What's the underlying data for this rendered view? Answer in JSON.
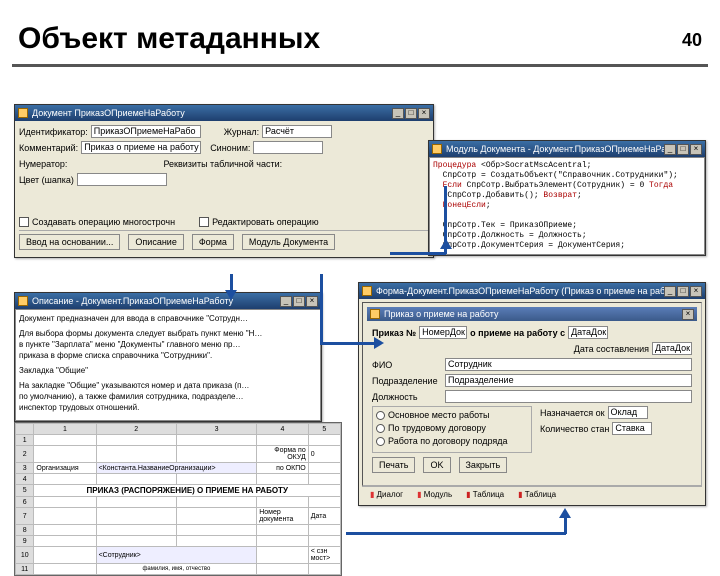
{
  "page_number": "40",
  "heading": "Объект метаданных",
  "doc_win": {
    "title": "Документ ПриказОПриемеНаРаботу",
    "labels": {
      "ident": "Идентификатор:",
      "ident_val": "ПриказОПриемеНаРабо",
      "journal": "Журнал:",
      "journal_val": "Расчёт",
      "comment": "Комментарий:",
      "comment_val": "Приказ о приеме на работу",
      "synonym": "Синоним:",
      "synonym_val": "",
      "numerator": "Нумератор:",
      "numerator_val": "",
      "unique": "Реквизиты табличной части:",
      "head": "Цвет (шапка)"
    },
    "checkboxes": {
      "create_op": "Создавать операцию многострочн",
      "edit_op": "Редактировать операцию"
    },
    "buttons": {
      "print": "Ввод на основании...",
      "desc": "Описание",
      "form": "Форма",
      "module": "Модуль Документа"
    }
  },
  "module_win": {
    "title": "Модуль Документа - Документ.ПриказОПриемеНаРаботу",
    "code_lines": [
      "Процедура <Обр>SocratMscAcentral;",
      "  СпрСотр = СоздатьОбъект(\"Справочник.Сотрудники\");",
      "  Если СпрСотр.ВыбратьЭлемент(Сотрудник) = 0 Тогда",
      "   СпрСотр.Добавить(); Возврат;",
      "  КонецЕсли;",
      "",
      "  СпрСотр.Тек = ПриказОПриеме;",
      "  СпрСотр.Должность = Должность;",
      "  СпрСотр.ДокументСерия = ДокументСерия;"
    ]
  },
  "desc_win": {
    "title": "Описание - Документ.ПриказОПриемеНаРаботу",
    "paragraphs": [
      "Документ предназначен для ввода в справочнике \"Сотрудн…",
      "Для выбора формы документа следует выбрать пункт меню \"Н…\nв пункте \"Зарплата\" меню \"Документы\" главного меню пр…\nприказа в форме списка справочника \"Сотрудники\".",
      "Закладка \"Общие\"",
      "На закладке \"Общие\" указываются номер и дата приказа (п…\nпо умолчанию), а также фамилия сотрудника, подразделе…\nинспектор трудовых отношений."
    ]
  },
  "sheet": {
    "header_cols": [
      "1",
      "2",
      "3",
      "4",
      "5"
    ],
    "rows": [
      "1",
      "2",
      "3",
      "4",
      "5",
      "6",
      "7",
      "8",
      "9",
      "10",
      "11"
    ],
    "cells": {
      "r2c4": "Форма по ОКУД",
      "r2c5": "0",
      "r3c2": "Организация",
      "r3c3": "<Константа.НазваниеОрганизации>",
      "r3c5": "по ОКПО",
      "r5": "ПРИКАЗ (РАСПОРЯЖЕНИЕ) О ПРИЕМЕ НА РАБОТУ",
      "r7c4": "Номер документа",
      "r7c5": "Дата",
      "r9c2": "",
      "r10c2": "<Сотрудник>",
      "r10c5": "< сзн мост>",
      "r11c2": "фамилия, имя, отчество"
    }
  },
  "form_win": {
    "title": "Форма-Документ.ПриказОПриемеНаРаботу (Приказ о приеме на раб…",
    "inner_title": "Приказ о приеме на работу",
    "fields": {
      "num_lbl": "Приказ №",
      "num_val": "НомерДок",
      "date_part": " о приеме на работу с ",
      "date_fld": "ДатаДок",
      "datecr_lbl": "Дата составления",
      "datecr_val": "ДатаДок",
      "fio_lbl": "ФИО",
      "fio_val": "Сотрудник",
      "podr_lbl": "Подразделение",
      "podr_val": "Подразделение",
      "dolzh_lbl": "Должность",
      "dolzh_val": ""
    },
    "radios": {
      "r1": "Основное место работы",
      "r2": "По трудовому договору",
      "r3": "Работа по договору подряда"
    },
    "side": {
      "naz_lbl": "Назначается ок",
      "naz_val": "Оклад",
      "kol_lbl": "Количество стан",
      "kol_val": "Ставка"
    },
    "buttons": {
      "print": "Печать",
      "ok": "OK",
      "close": "Закрыть"
    },
    "tabs": {
      "dialog": "Диалог",
      "module": "Модуль",
      "table": "Таблица",
      "table2": "Таблица"
    }
  }
}
